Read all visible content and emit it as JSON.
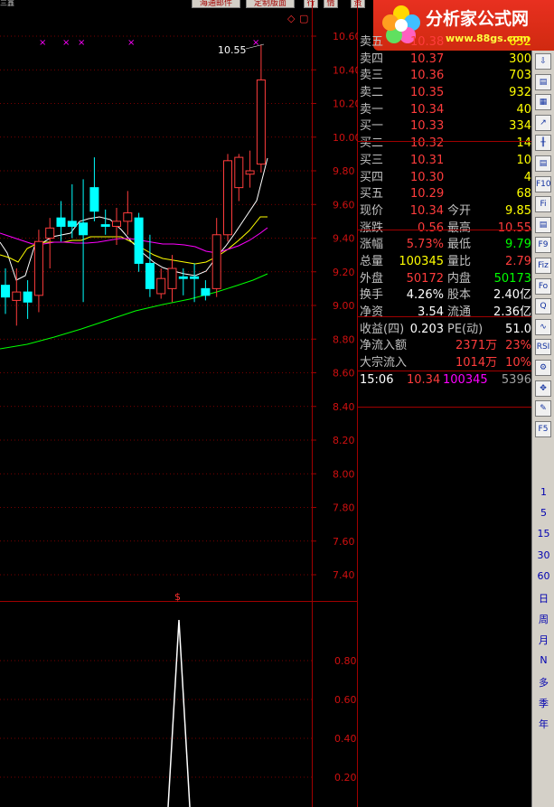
{
  "top_left": "三鑫",
  "top_buttons": [
    "海通邮件",
    "定制版面",
    "行",
    "情",
    "资"
  ],
  "price_axis": {
    "ticks": [
      "10.60",
      "10.40",
      "10.20",
      "10.00",
      "9.80",
      "9.60",
      "9.40",
      "9.20",
      "9.00",
      "8.80",
      "8.60",
      "8.40",
      "8.20",
      "8.00",
      "7.80",
      "7.60",
      "7.40"
    ],
    "min": 7.2,
    "max": 10.7
  },
  "indicator_axis": {
    "ticks": [
      "0.80",
      "0.60",
      "0.40",
      "0.20"
    ]
  },
  "chart_annotations": {
    "high_label": "10.55",
    "signal_marker": "$"
  },
  "colors": {
    "up": "#ff3c3c",
    "down": "#00ffff",
    "ma5": "#ffffff",
    "ma10": "#ffff00",
    "ma20": "#ff00ff",
    "ma60": "#00ff00",
    "grid": "#a00000"
  },
  "candles": [
    {
      "o": 9.12,
      "h": 9.22,
      "l": 8.95,
      "c": 9.05
    },
    {
      "o": 9.03,
      "h": 9.22,
      "l": 8.88,
      "c": 9.08
    },
    {
      "o": 9.08,
      "h": 9.15,
      "l": 8.92,
      "c": 9.02
    },
    {
      "o": 9.06,
      "h": 9.45,
      "l": 8.96,
      "c": 9.38
    },
    {
      "o": 9.4,
      "h": 9.52,
      "l": 9.22,
      "c": 9.46
    },
    {
      "o": 9.52,
      "h": 9.62,
      "l": 9.38,
      "c": 9.47
    },
    {
      "o": 9.5,
      "h": 9.72,
      "l": 9.4,
      "c": 9.47
    },
    {
      "o": 9.49,
      "h": 9.75,
      "l": 9.02,
      "c": 9.42
    },
    {
      "o": 9.7,
      "h": 9.88,
      "l": 9.5,
      "c": 9.56
    },
    {
      "o": 9.48,
      "h": 9.57,
      "l": 9.42,
      "c": 9.47
    },
    {
      "o": 9.47,
      "h": 9.58,
      "l": 9.36,
      "c": 9.5
    },
    {
      "o": 9.5,
      "h": 9.68,
      "l": 9.42,
      "c": 9.55
    },
    {
      "o": 9.52,
      "h": 9.55,
      "l": 9.2,
      "c": 9.25
    },
    {
      "o": 9.25,
      "h": 9.42,
      "l": 9.05,
      "c": 9.1
    },
    {
      "o": 9.07,
      "h": 9.22,
      "l": 9.04,
      "c": 9.16
    },
    {
      "o": 9.1,
      "h": 9.3,
      "l": 9.02,
      "c": 9.22
    },
    {
      "o": 9.17,
      "h": 9.22,
      "l": 9.06,
      "c": 9.16
    },
    {
      "o": 9.17,
      "h": 9.25,
      "l": 9.02,
      "c": 9.16
    },
    {
      "o": 9.1,
      "h": 9.15,
      "l": 9.03,
      "c": 9.06
    },
    {
      "o": 9.1,
      "h": 9.52,
      "l": 9.05,
      "c": 9.42
    },
    {
      "o": 9.42,
      "h": 9.9,
      "l": 9.38,
      "c": 9.86
    },
    {
      "o": 9.7,
      "h": 9.9,
      "l": 9.62,
      "c": 9.88
    },
    {
      "o": 9.78,
      "h": 9.92,
      "l": 9.7,
      "c": 9.8
    },
    {
      "o": 9.84,
      "h": 10.55,
      "l": 9.79,
      "c": 10.34
    }
  ],
  "quote": {
    "asks": [
      {
        "label": "卖五",
        "price": "10.38",
        "vol": "652"
      },
      {
        "label": "卖四",
        "price": "10.37",
        "vol": "300"
      },
      {
        "label": "卖三",
        "price": "10.36",
        "vol": "703"
      },
      {
        "label": "卖二",
        "price": "10.35",
        "vol": "932"
      },
      {
        "label": "卖一",
        "price": "10.34",
        "vol": "40"
      }
    ],
    "bids": [
      {
        "label": "买一",
        "price": "10.33",
        "vol": "334"
      },
      {
        "label": "买二",
        "price": "10.32",
        "vol": "14"
      },
      {
        "label": "买三",
        "price": "10.31",
        "vol": "10"
      },
      {
        "label": "买四",
        "price": "10.30",
        "vol": "4"
      },
      {
        "label": "买五",
        "price": "10.29",
        "vol": "68"
      }
    ],
    "stats": [
      {
        "l1": "现价",
        "v1": "10.34",
        "l2": "今开",
        "v2": "9.85"
      },
      {
        "l1": "涨跌",
        "v1": "0.56",
        "l2": "最高",
        "v2": "10.55"
      },
      {
        "l1": "涨幅",
        "v1": "5.73%",
        "l2": "最低",
        "v2": "9.79"
      },
      {
        "l1": "总量",
        "v1": "100345",
        "l2": "量比",
        "v2": "2.79"
      },
      {
        "l1": "外盘",
        "v1": "50172",
        "l2": "内盘",
        "v2": "50173"
      }
    ],
    "finance": [
      {
        "l1": "换手",
        "v1": "4.26%",
        "l2": "股本",
        "v2": "2.40亿"
      },
      {
        "l1": "净资",
        "v1": "3.54",
        "l2": "流通",
        "v2": "2.36亿"
      },
      {
        "l1": "收益(四)",
        "v1": "0.203",
        "l2": "PE(动)",
        "v2": "51.0"
      }
    ],
    "flows": [
      {
        "label": "净流入额",
        "value": "2371万",
        "pct": "23%"
      },
      {
        "label": "大宗流入",
        "value": "1014万",
        "pct": "10%"
      }
    ],
    "tick": {
      "time": "15:06",
      "price": "10.34",
      "vol": "100345",
      "count": "5396"
    }
  },
  "brand": {
    "title": "分析家公式网",
    "url": "www.88gs.com"
  },
  "toolbar": {
    "icons": [
      "down-arrow-icon",
      "chart-icon",
      "table-icon",
      "line-chart-icon",
      "candle-icon",
      "report-icon",
      "f10-icon",
      "f11-icon",
      "f12-icon",
      "f9-icon",
      "fx-icon",
      "search-icon",
      "wave-icon",
      "rsi-icon",
      "gear-icon",
      "move-icon",
      "pencil-icon",
      "f5-icon",
      "number-1-icon"
    ],
    "icon_texts": [
      "⇩",
      "▤",
      "▦",
      "↗",
      "╫",
      "▤",
      "F10",
      "Fi",
      "▤",
      "F9",
      "Fiz",
      "Fo",
      "Q",
      "∿",
      "RSI",
      "⚙",
      "✥",
      "✎",
      "F5",
      "1"
    ],
    "periods": [
      "1",
      "5",
      "15",
      "30",
      "60",
      "日",
      "周",
      "月",
      "N",
      "多",
      "季",
      "年"
    ]
  }
}
